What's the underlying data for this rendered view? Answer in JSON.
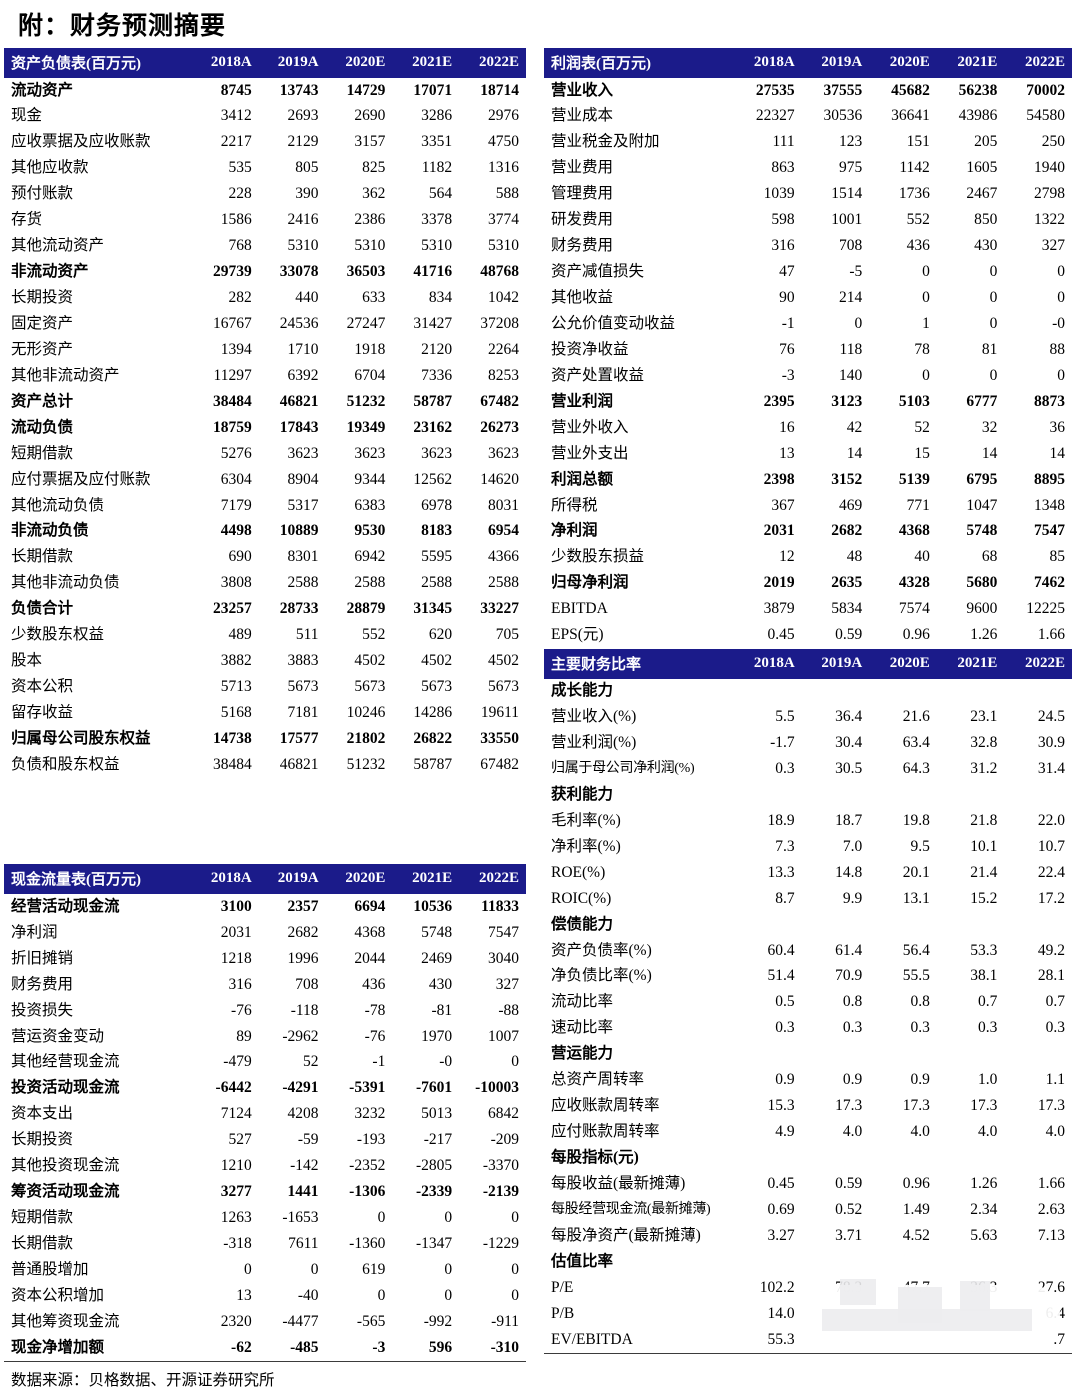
{
  "title": "附：财务预测摘要",
  "source_note": "数据来源：贝格数据、开源证券研究所",
  "colors": {
    "header_bg": "#1b1b8a",
    "header_text": "#ffffff",
    "rule": "#3b3b3b"
  },
  "years": [
    "2018A",
    "2019A",
    "2020E",
    "2021E",
    "2022E"
  ],
  "balance_sheet": {
    "header": "资产负债表(百万元)",
    "rows": [
      {
        "label": "流动资产",
        "bold": true,
        "values": [
          "8745",
          "13743",
          "14729",
          "17071",
          "18714"
        ]
      },
      {
        "label": "现金",
        "bold": false,
        "values": [
          "3412",
          "2693",
          "2690",
          "3286",
          "2976"
        ]
      },
      {
        "label": "应收票据及应收账款",
        "bold": false,
        "values": [
          "2217",
          "2129",
          "3157",
          "3351",
          "4750"
        ]
      },
      {
        "label": "其他应收款",
        "bold": false,
        "values": [
          "535",
          "805",
          "825",
          "1182",
          "1316"
        ]
      },
      {
        "label": "预付账款",
        "bold": false,
        "values": [
          "228",
          "390",
          "362",
          "564",
          "588"
        ]
      },
      {
        "label": "存货",
        "bold": false,
        "values": [
          "1586",
          "2416",
          "2386",
          "3378",
          "3774"
        ]
      },
      {
        "label": "其他流动资产",
        "bold": false,
        "values": [
          "768",
          "5310",
          "5310",
          "5310",
          "5310"
        ]
      },
      {
        "label": "非流动资产",
        "bold": true,
        "values": [
          "29739",
          "33078",
          "36503",
          "41716",
          "48768"
        ]
      },
      {
        "label": "长期投资",
        "bold": false,
        "values": [
          "282",
          "440",
          "633",
          "834",
          "1042"
        ]
      },
      {
        "label": "固定资产",
        "bold": false,
        "values": [
          "16767",
          "24536",
          "27247",
          "31427",
          "37208"
        ]
      },
      {
        "label": "无形资产",
        "bold": false,
        "values": [
          "1394",
          "1710",
          "1918",
          "2120",
          "2264"
        ]
      },
      {
        "label": "其他非流动资产",
        "bold": false,
        "values": [
          "11297",
          "6392",
          "6704",
          "7336",
          "8253"
        ]
      },
      {
        "label": "资产总计",
        "bold": true,
        "values": [
          "38484",
          "46821",
          "51232",
          "58787",
          "67482"
        ]
      },
      {
        "label": "流动负债",
        "bold": true,
        "values": [
          "18759",
          "17843",
          "19349",
          "23162",
          "26273"
        ]
      },
      {
        "label": "短期借款",
        "bold": false,
        "values": [
          "5276",
          "3623",
          "3623",
          "3623",
          "3623"
        ]
      },
      {
        "label": "应付票据及应付账款",
        "bold": false,
        "values": [
          "6304",
          "8904",
          "9344",
          "12562",
          "14620"
        ]
      },
      {
        "label": "其他流动负债",
        "bold": false,
        "values": [
          "7179",
          "5317",
          "6383",
          "6978",
          "8031"
        ]
      },
      {
        "label": "非流动负债",
        "bold": true,
        "values": [
          "4498",
          "10889",
          "9530",
          "8183",
          "6954"
        ]
      },
      {
        "label": "长期借款",
        "bold": false,
        "values": [
          "690",
          "8301",
          "6942",
          "5595",
          "4366"
        ]
      },
      {
        "label": "其他非流动负债",
        "bold": false,
        "values": [
          "3808",
          "2588",
          "2588",
          "2588",
          "2588"
        ]
      },
      {
        "label": "负债合计",
        "bold": true,
        "values": [
          "23257",
          "28733",
          "28879",
          "31345",
          "33227"
        ]
      },
      {
        "label": "少数股东权益",
        "bold": false,
        "values": [
          "489",
          "511",
          "552",
          "620",
          "705"
        ]
      },
      {
        "label": "股本",
        "bold": false,
        "values": [
          "3882",
          "3883",
          "4502",
          "4502",
          "4502"
        ]
      },
      {
        "label": "资本公积",
        "bold": false,
        "values": [
          "5713",
          "5673",
          "5673",
          "5673",
          "5673"
        ]
      },
      {
        "label": "留存收益",
        "bold": false,
        "values": [
          "5168",
          "7181",
          "10246",
          "14286",
          "19611"
        ]
      },
      {
        "label": "归属母公司股东权益",
        "bold": true,
        "values": [
          "14738",
          "17577",
          "21802",
          "26822",
          "33550"
        ]
      },
      {
        "label": "负债和股东权益",
        "bold": false,
        "values": [
          "38484",
          "46821",
          "51232",
          "58787",
          "67482"
        ]
      }
    ]
  },
  "cash_flow": {
    "header": "现金流量表(百万元)",
    "rows": [
      {
        "label": "经营活动现金流",
        "bold": true,
        "values": [
          "3100",
          "2357",
          "6694",
          "10536",
          "11833"
        ]
      },
      {
        "label": "净利润",
        "bold": false,
        "values": [
          "2031",
          "2682",
          "4368",
          "5748",
          "7547"
        ]
      },
      {
        "label": "折旧摊销",
        "bold": false,
        "values": [
          "1218",
          "1996",
          "2044",
          "2469",
          "3040"
        ]
      },
      {
        "label": "财务费用",
        "bold": false,
        "values": [
          "316",
          "708",
          "436",
          "430",
          "327"
        ]
      },
      {
        "label": "投资损失",
        "bold": false,
        "values": [
          "-76",
          "-118",
          "-78",
          "-81",
          "-88"
        ]
      },
      {
        "label": "营运资金变动",
        "bold": false,
        "values": [
          "89",
          "-2962",
          "-76",
          "1970",
          "1007"
        ]
      },
      {
        "label": "其他经营现金流",
        "bold": false,
        "values": [
          "-479",
          "52",
          "-1",
          "-0",
          "0"
        ]
      },
      {
        "label": "投资活动现金流",
        "bold": true,
        "values": [
          "-6442",
          "-4291",
          "-5391",
          "-7601",
          "-10003"
        ]
      },
      {
        "label": "资本支出",
        "bold": false,
        "values": [
          "7124",
          "4208",
          "3232",
          "5013",
          "6842"
        ]
      },
      {
        "label": "长期投资",
        "bold": false,
        "values": [
          "527",
          "-59",
          "-193",
          "-217",
          "-209"
        ]
      },
      {
        "label": "其他投资现金流",
        "bold": false,
        "values": [
          "1210",
          "-142",
          "-2352",
          "-2805",
          "-3370"
        ]
      },
      {
        "label": "筹资活动现金流",
        "bold": true,
        "values": [
          "3277",
          "1441",
          "-1306",
          "-2339",
          "-2139"
        ]
      },
      {
        "label": "短期借款",
        "bold": false,
        "values": [
          "1263",
          "-1653",
          "0",
          "0",
          "0"
        ]
      },
      {
        "label": "长期借款",
        "bold": false,
        "values": [
          "-318",
          "7611",
          "-1360",
          "-1347",
          "-1229"
        ]
      },
      {
        "label": "普通股增加",
        "bold": false,
        "values": [
          "0",
          "0",
          "619",
          "0",
          "0"
        ]
      },
      {
        "label": "资本公积增加",
        "bold": false,
        "values": [
          "13",
          "-40",
          "0",
          "0",
          "0"
        ]
      },
      {
        "label": "其他筹资现金流",
        "bold": false,
        "values": [
          "2320",
          "-4477",
          "-565",
          "-992",
          "-911"
        ]
      },
      {
        "label": "现金净增加额",
        "bold": true,
        "values": [
          "-62",
          "-485",
          "-3",
          "596",
          "-310"
        ]
      }
    ]
  },
  "income_statement": {
    "header": "利润表(百万元)",
    "rows": [
      {
        "label": "营业收入",
        "bold": true,
        "values": [
          "27535",
          "37555",
          "45682",
          "56238",
          "70002"
        ]
      },
      {
        "label": "营业成本",
        "bold": false,
        "values": [
          "22327",
          "30536",
          "36641",
          "43986",
          "54580"
        ]
      },
      {
        "label": "营业税金及附加",
        "bold": false,
        "values": [
          "111",
          "123",
          "151",
          "205",
          "250"
        ]
      },
      {
        "label": "营业费用",
        "bold": false,
        "values": [
          "863",
          "975",
          "1142",
          "1605",
          "1940"
        ]
      },
      {
        "label": "管理费用",
        "bold": false,
        "values": [
          "1039",
          "1514",
          "1736",
          "2467",
          "2798"
        ]
      },
      {
        "label": "研发费用",
        "bold": false,
        "values": [
          "598",
          "1001",
          "552",
          "850",
          "1322"
        ]
      },
      {
        "label": "财务费用",
        "bold": false,
        "values": [
          "316",
          "708",
          "436",
          "430",
          "327"
        ]
      },
      {
        "label": "资产减值损失",
        "bold": false,
        "values": [
          "47",
          "-5",
          "0",
          "0",
          "0"
        ]
      },
      {
        "label": "其他收益",
        "bold": false,
        "values": [
          "90",
          "214",
          "0",
          "0",
          "0"
        ]
      },
      {
        "label": "公允价值变动收益",
        "bold": false,
        "values": [
          "-1",
          "0",
          "1",
          "0",
          "-0"
        ]
      },
      {
        "label": "投资净收益",
        "bold": false,
        "values": [
          "76",
          "118",
          "78",
          "81",
          "88"
        ]
      },
      {
        "label": "资产处置收益",
        "bold": false,
        "values": [
          "-3",
          "140",
          "0",
          "0",
          "0"
        ]
      },
      {
        "label": "营业利润",
        "bold": true,
        "values": [
          "2395",
          "3123",
          "5103",
          "6777",
          "8873"
        ]
      },
      {
        "label": "营业外收入",
        "bold": false,
        "values": [
          "16",
          "42",
          "52",
          "32",
          "36"
        ]
      },
      {
        "label": "营业外支出",
        "bold": false,
        "values": [
          "13",
          "14",
          "15",
          "14",
          "14"
        ]
      },
      {
        "label": "利润总额",
        "bold": true,
        "values": [
          "2398",
          "3152",
          "5139",
          "6795",
          "8895"
        ]
      },
      {
        "label": "所得税",
        "bold": false,
        "values": [
          "367",
          "469",
          "771",
          "1047",
          "1348"
        ]
      },
      {
        "label": "净利润",
        "bold": true,
        "values": [
          "2031",
          "2682",
          "4368",
          "5748",
          "7547"
        ]
      },
      {
        "label": "少数股东损益",
        "bold": false,
        "values": [
          "12",
          "48",
          "40",
          "68",
          "85"
        ]
      },
      {
        "label": "归母净利润",
        "bold": true,
        "values": [
          "2019",
          "2635",
          "4328",
          "5680",
          "7462"
        ]
      },
      {
        "label": "EBITDA",
        "bold": false,
        "values": [
          "3879",
          "5834",
          "7574",
          "9600",
          "12225"
        ]
      },
      {
        "label": "EPS(元)",
        "bold": false,
        "values": [
          "0.45",
          "0.59",
          "0.96",
          "1.26",
          "1.66"
        ]
      }
    ]
  },
  "ratios": {
    "header": "主要财务比率",
    "rows": [
      {
        "label": "成长能力",
        "section": true,
        "values": [
          "",
          "",
          "",
          "",
          ""
        ]
      },
      {
        "label": "营业收入(%)",
        "values": [
          "5.5",
          "36.4",
          "21.6",
          "23.1",
          "24.5"
        ]
      },
      {
        "label": "营业利润(%)",
        "values": [
          "-1.7",
          "30.4",
          "63.4",
          "32.8",
          "30.9"
        ]
      },
      {
        "label": "归属于母公司净利润(%)",
        "squeeze": true,
        "values": [
          "0.3",
          "30.5",
          "64.3",
          "31.2",
          "31.4"
        ]
      },
      {
        "label": "获利能力",
        "section": true,
        "values": [
          "",
          "",
          "",
          "",
          ""
        ]
      },
      {
        "label": "毛利率(%)",
        "values": [
          "18.9",
          "18.7",
          "19.8",
          "21.8",
          "22.0"
        ]
      },
      {
        "label": "净利率(%)",
        "values": [
          "7.3",
          "7.0",
          "9.5",
          "10.1",
          "10.7"
        ]
      },
      {
        "label": "ROE(%)",
        "values": [
          "13.3",
          "14.8",
          "20.1",
          "21.4",
          "22.4"
        ]
      },
      {
        "label": "ROIC(%)",
        "values": [
          "8.7",
          "9.9",
          "13.1",
          "15.2",
          "17.2"
        ]
      },
      {
        "label": "偿债能力",
        "section": true,
        "values": [
          "",
          "",
          "",
          "",
          ""
        ]
      },
      {
        "label": "资产负债率(%)",
        "values": [
          "60.4",
          "61.4",
          "56.4",
          "53.3",
          "49.2"
        ]
      },
      {
        "label": "净负债比率(%)",
        "values": [
          "51.4",
          "70.9",
          "55.5",
          "38.1",
          "28.1"
        ]
      },
      {
        "label": "流动比率",
        "values": [
          "0.5",
          "0.8",
          "0.8",
          "0.7",
          "0.7"
        ]
      },
      {
        "label": "速动比率",
        "values": [
          "0.3",
          "0.3",
          "0.3",
          "0.3",
          "0.3"
        ]
      },
      {
        "label": "营运能力",
        "section": true,
        "values": [
          "",
          "",
          "",
          "",
          ""
        ]
      },
      {
        "label": "总资产周转率",
        "values": [
          "0.9",
          "0.9",
          "0.9",
          "1.0",
          "1.1"
        ]
      },
      {
        "label": "应收账款周转率",
        "values": [
          "15.3",
          "17.3",
          "17.3",
          "17.3",
          "17.3"
        ]
      },
      {
        "label": "应付账款周转率",
        "values": [
          "4.9",
          "4.0",
          "4.0",
          "4.0",
          "4.0"
        ]
      },
      {
        "label": "每股指标(元)",
        "section": true,
        "values": [
          "",
          "",
          "",
          "",
          ""
        ]
      },
      {
        "label": "每股收益(最新摊薄)",
        "values": [
          "0.45",
          "0.59",
          "0.96",
          "1.26",
          "1.66"
        ]
      },
      {
        "label": "每股经营现金流(最新摊薄)",
        "squeeze": true,
        "values": [
          "0.69",
          "0.52",
          "1.49",
          "2.34",
          "2.63"
        ]
      },
      {
        "label": "每股净资产(最新摊薄)",
        "values": [
          "3.27",
          "3.71",
          "4.52",
          "5.63",
          "7.13"
        ]
      },
      {
        "label": "估值比率",
        "section": true,
        "values": [
          "",
          "",
          "",
          "",
          ""
        ]
      },
      {
        "label": "P/E",
        "values": [
          "102.2",
          "78.3",
          "47.7",
          "36.3",
          "27.6"
        ]
      },
      {
        "label": "P/B",
        "values": [
          "14.0",
          "",
          "",
          "",
          "6.4"
        ]
      },
      {
        "label": "EV/EBITDA",
        "values": [
          "55.3",
          "",
          "",
          "",
          ".7"
        ]
      }
    ]
  }
}
